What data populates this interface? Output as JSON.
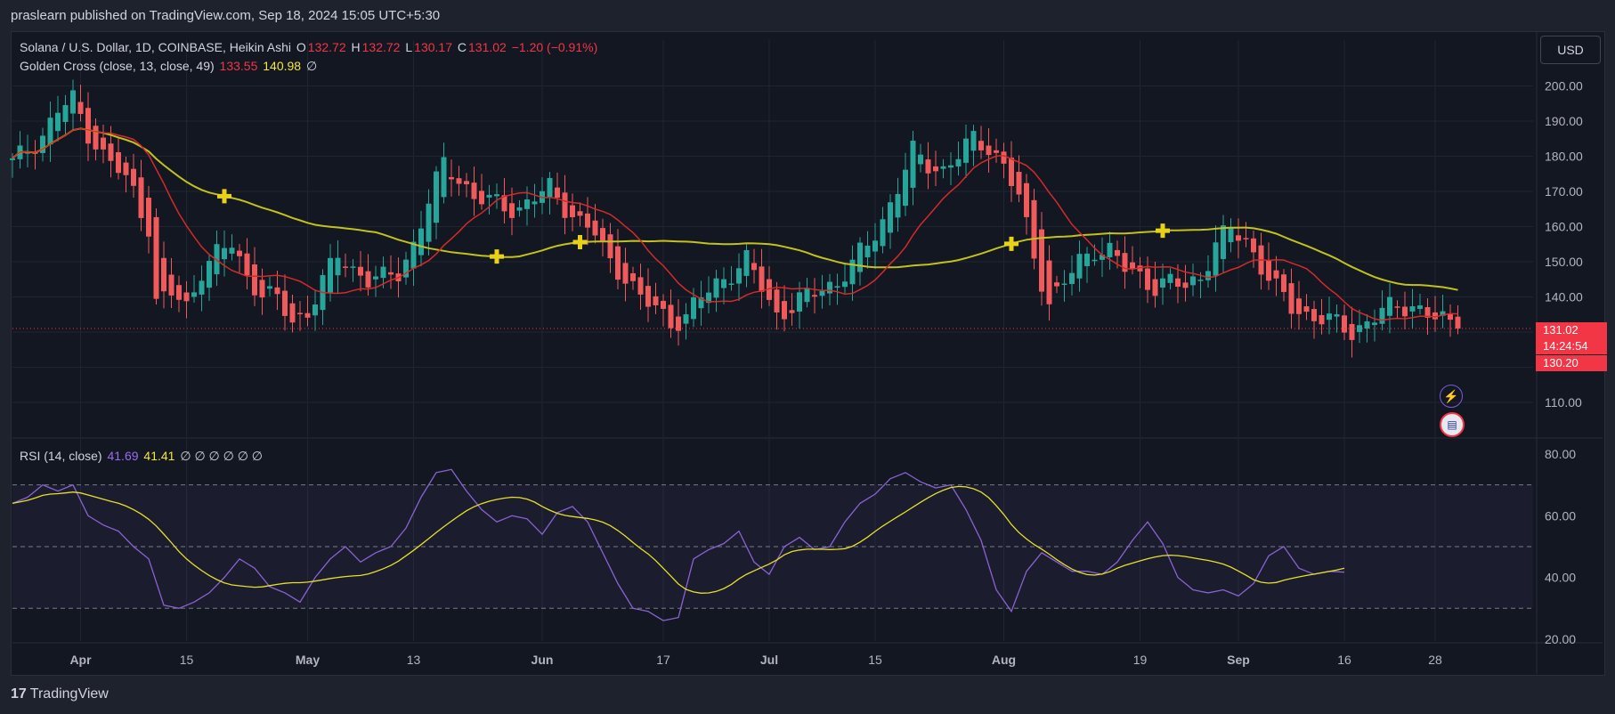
{
  "header": {
    "author_line": "praslearn published on TradingView.com, Sep 18, 2024 15:05 UTC+5:30"
  },
  "legend_main": {
    "symbol": "Solana / U.S. Dollar, 1D, COINBASE, Heikin Ashi",
    "o_label": "O",
    "o": "132.72",
    "h_label": "H",
    "h": "132.72",
    "l_label": "L",
    "l": "130.17",
    "c_label": "C",
    "c": "131.02",
    "change": "−1.20 (−0.91%)"
  },
  "legend_gc": {
    "name": "Golden Cross (close, 13, close, 49)",
    "v1": "133.55",
    "v2": "140.98",
    "extra": "∅"
  },
  "legend_rsi": {
    "name": "RSI (14, close)",
    "v1": "41.69",
    "v2": "41.41",
    "extra": "∅ ∅ ∅ ∅ ∅ ∅"
  },
  "currency": "USD",
  "price_tags": {
    "last": "131.02",
    "countdown": "14:24:54",
    "low": "130.20"
  },
  "brand": {
    "logo": "17",
    "name": "TradingView"
  },
  "icons": {
    "lightning": "lightning-icon",
    "flag": "us-flag-icon"
  },
  "colors": {
    "up": "#26a69a",
    "down": "#f05a5a",
    "sma13": "#d42a2a",
    "sma49": "#c3c11c",
    "rsi": "#8a63d2",
    "rsi_ma": "#e6e02a",
    "last_price": "#f23645"
  },
  "chart_data": [
    {
      "type": "candlestick",
      "subtitle": "Heikin Ashi",
      "y_scale": "linear",
      "ylim": [
        100,
        210
      ],
      "y_ticks": [
        "200.00",
        "190.00",
        "180.00",
        "170.00",
        "160.00",
        "150.00",
        "140.00",
        "110.00"
      ],
      "x_ticks": [
        "Apr",
        "15",
        "May",
        "13",
        "Jun",
        "17",
        "Jul",
        "15",
        "Aug",
        "19",
        "Sep",
        "16",
        "28"
      ],
      "x_tick_days": [
        9,
        23,
        39,
        53,
        70,
        86,
        100,
        114,
        131,
        149,
        162,
        176,
        188
      ],
      "grid": true,
      "last_price": 131.02,
      "anchors": [
        [
          0,
          178
        ],
        [
          2,
          182
        ],
        [
          4,
          186
        ],
        [
          6,
          193
        ],
        [
          8,
          196
        ],
        [
          10,
          187
        ],
        [
          12,
          180
        ],
        [
          14,
          176
        ],
        [
          16,
          170
        ],
        [
          18,
          160
        ],
        [
          19,
          138
        ],
        [
          21,
          141
        ],
        [
          23,
          137
        ],
        [
          25,
          148
        ],
        [
          27,
          152
        ],
        [
          29,
          155
        ],
        [
          31,
          146
        ],
        [
          33,
          141
        ],
        [
          35,
          139
        ],
        [
          37,
          133
        ],
        [
          39,
          136
        ],
        [
          41,
          144
        ],
        [
          43,
          152
        ],
        [
          45,
          148
        ],
        [
          47,
          145
        ],
        [
          49,
          145
        ],
        [
          51,
          147
        ],
        [
          53,
          155
        ],
        [
          55,
          167
        ],
        [
          57,
          178
        ],
        [
          59,
          174
        ],
        [
          61,
          168
        ],
        [
          63,
          167
        ],
        [
          65,
          166
        ],
        [
          67,
          165
        ],
        [
          69,
          168
        ],
        [
          71,
          171
        ],
        [
          73,
          166
        ],
        [
          75,
          161
        ],
        [
          77,
          158
        ],
        [
          79,
          150
        ],
        [
          81,
          146
        ],
        [
          83,
          139
        ],
        [
          85,
          137
        ],
        [
          87,
          133
        ],
        [
          89,
          134
        ],
        [
          91,
          140
        ],
        [
          93,
          144
        ],
        [
          95,
          147
        ],
        [
          97,
          150
        ],
        [
          99,
          143
        ],
        [
          101,
          135
        ],
        [
          103,
          137
        ],
        [
          105,
          140
        ],
        [
          107,
          143
        ],
        [
          109,
          144
        ],
        [
          111,
          149
        ],
        [
          113,
          155
        ],
        [
          115,
          162
        ],
        [
          117,
          171
        ],
        [
          119,
          181
        ],
        [
          121,
          178
        ],
        [
          123,
          176
        ],
        [
          125,
          180
        ],
        [
          127,
          185
        ],
        [
          129,
          183
        ],
        [
          131,
          177
        ],
        [
          133,
          168
        ],
        [
          135,
          152
        ],
        [
          137,
          138
        ],
        [
          139,
          144
        ],
        [
          141,
          150
        ],
        [
          143,
          154
        ],
        [
          145,
          153
        ],
        [
          147,
          148
        ],
        [
          149,
          146
        ],
        [
          151,
          143
        ],
        [
          153,
          144
        ],
        [
          155,
          143
        ],
        [
          157,
          146
        ],
        [
          159,
          155
        ],
        [
          161,
          159
        ],
        [
          163,
          156
        ],
        [
          165,
          149
        ],
        [
          167,
          142
        ],
        [
          169,
          137
        ],
        [
          171,
          135
        ],
        [
          173,
          134
        ],
        [
          175,
          132
        ],
        [
          177,
          130
        ],
        [
          179,
          133
        ],
        [
          181,
          136
        ],
        [
          183,
          137
        ],
        [
          185,
          138
        ],
        [
          187,
          135
        ],
        [
          189,
          133
        ],
        [
          191,
          131.02
        ]
      ],
      "series": [
        {
          "name": "133.55",
          "period": 13
        },
        {
          "name": "140.98",
          "period": 49
        }
      ],
      "cross_markers_days": [
        28,
        64,
        75,
        132,
        152
      ]
    },
    {
      "type": "line",
      "title": "RSI (14, close)",
      "ylim": [
        20,
        80
      ],
      "y_ticks": [
        "80.00",
        "60.00",
        "40.00",
        "20.00"
      ],
      "bands": [
        70,
        50,
        30
      ],
      "rsi_anchors": [
        [
          0,
          64
        ],
        [
          2,
          66
        ],
        [
          4,
          70
        ],
        [
          6,
          68
        ],
        [
          8,
          70
        ],
        [
          10,
          60
        ],
        [
          12,
          57
        ],
        [
          14,
          55
        ],
        [
          16,
          50
        ],
        [
          18,
          46
        ],
        [
          20,
          31
        ],
        [
          22,
          30
        ],
        [
          24,
          32
        ],
        [
          26,
          35
        ],
        [
          28,
          40
        ],
        [
          30,
          46
        ],
        [
          32,
          43
        ],
        [
          34,
          37
        ],
        [
          36,
          35
        ],
        [
          38,
          32
        ],
        [
          40,
          40
        ],
        [
          42,
          46
        ],
        [
          44,
          50
        ],
        [
          46,
          45
        ],
        [
          48,
          48
        ],
        [
          50,
          50
        ],
        [
          52,
          56
        ],
        [
          54,
          66
        ],
        [
          56,
          74
        ],
        [
          58,
          75
        ],
        [
          60,
          68
        ],
        [
          62,
          62
        ],
        [
          64,
          58
        ],
        [
          66,
          60
        ],
        [
          68,
          59
        ],
        [
          70,
          54
        ],
        [
          72,
          61
        ],
        [
          74,
          63
        ],
        [
          76,
          58
        ],
        [
          78,
          48
        ],
        [
          80,
          38
        ],
        [
          82,
          30
        ],
        [
          84,
          29
        ],
        [
          86,
          26
        ],
        [
          88,
          27
        ],
        [
          90,
          46
        ],
        [
          92,
          49
        ],
        [
          94,
          51
        ],
        [
          96,
          55
        ],
        [
          98,
          45
        ],
        [
          100,
          41
        ],
        [
          102,
          50
        ],
        [
          104,
          53
        ],
        [
          106,
          49
        ],
        [
          108,
          50
        ],
        [
          110,
          58
        ],
        [
          112,
          64
        ],
        [
          114,
          67
        ],
        [
          116,
          72
        ],
        [
          118,
          74
        ],
        [
          120,
          71
        ],
        [
          122,
          69
        ],
        [
          124,
          70
        ],
        [
          126,
          62
        ],
        [
          128,
          52
        ],
        [
          130,
          36
        ],
        [
          132,
          29
        ],
        [
          134,
          42
        ],
        [
          136,
          48
        ],
        [
          138,
          45
        ],
        [
          140,
          42
        ],
        [
          142,
          42
        ],
        [
          144,
          41
        ],
        [
          146,
          45
        ],
        [
          148,
          52
        ],
        [
          150,
          58
        ],
        [
          152,
          51
        ],
        [
          154,
          40
        ],
        [
          156,
          36
        ],
        [
          158,
          35
        ],
        [
          160,
          36
        ],
        [
          162,
          34
        ],
        [
          164,
          38
        ],
        [
          166,
          47
        ],
        [
          168,
          50
        ],
        [
          170,
          43
        ],
        [
          172,
          41
        ],
        [
          174,
          42
        ],
        [
          176,
          41.69
        ]
      ],
      "rsi_ma_last": 41.41
    }
  ]
}
